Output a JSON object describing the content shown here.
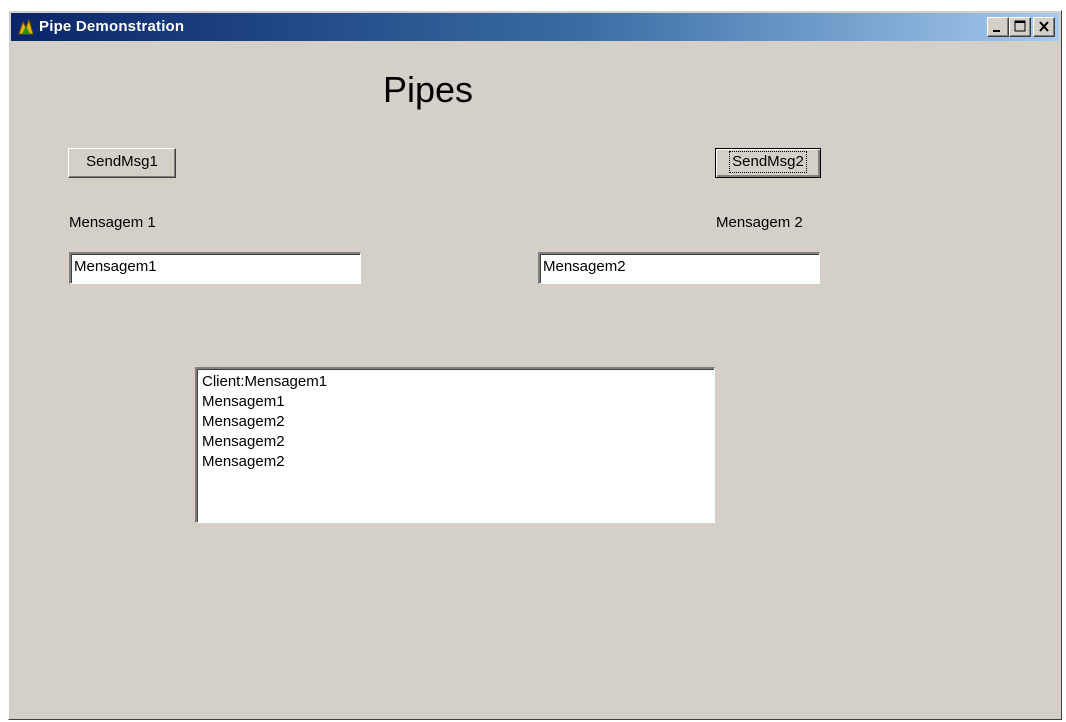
{
  "window": {
    "title": "Pipe Demonstration",
    "icon": "app-icon",
    "controls": [
      "minimize-icon",
      "maximize-icon",
      "close-icon"
    ]
  },
  "heading": "Pipes",
  "buttons": {
    "send1": "SendMsg1",
    "send2": "SendMsg2"
  },
  "labels": {
    "msg1": "Mensagem 1",
    "msg2": "Mensagem 2"
  },
  "fields": {
    "msg1_value": "Mensagem1",
    "msg2_value": "Mensagem2"
  },
  "log": {
    "lines": [
      "Client:Mensagem1",
      "Mensagem1",
      "Mensagem2",
      "Mensagem2",
      "Mensagem2"
    ]
  },
  "colors": {
    "face": "#d4d0c8",
    "title_start": "#0a246a",
    "title_end": "#a6caf0"
  }
}
